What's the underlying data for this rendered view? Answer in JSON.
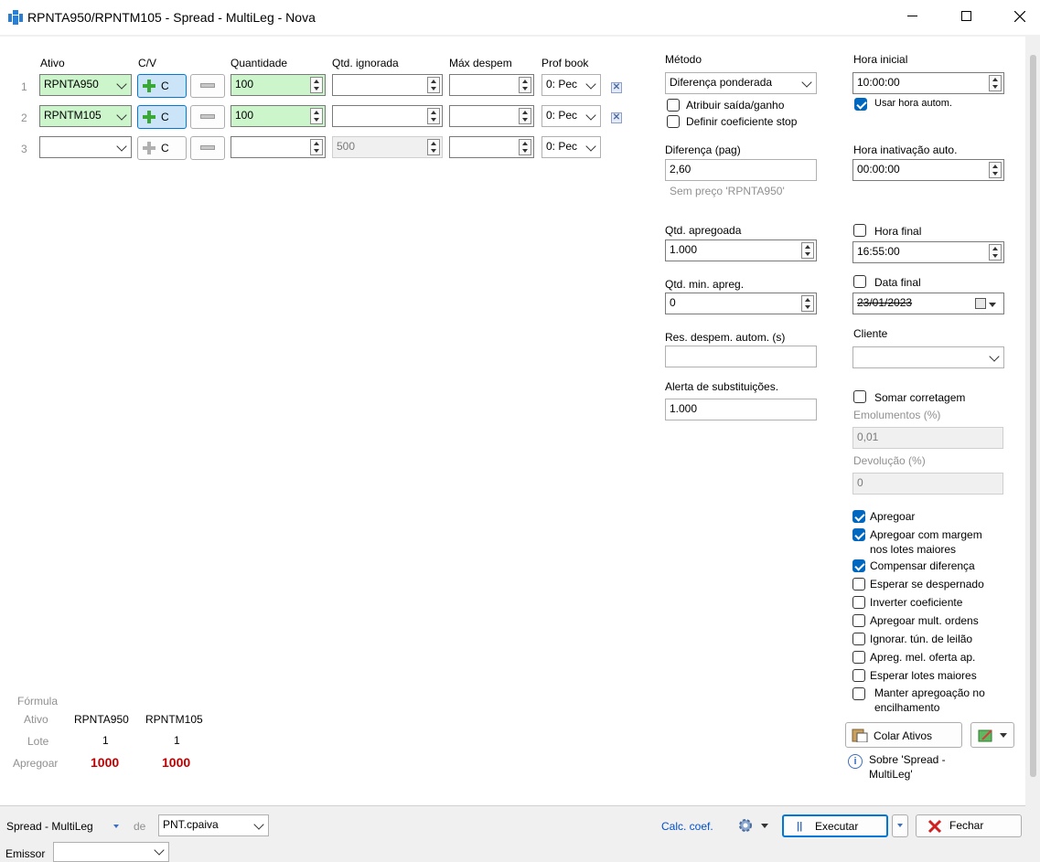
{
  "window": {
    "title": "RPNTA950/RPNTM105 - Spread - MultiLeg - Nova"
  },
  "grid": {
    "headers": {
      "ativo": "Ativo",
      "cv": "C/V",
      "quantidade": "Quantidade",
      "qtd_ignorada": "Qtd. ignorada",
      "max_despem": "Máx despem",
      "prof_book": "Prof book"
    },
    "rows": [
      {
        "num": "1",
        "ativo": "RPNTA950",
        "cv": "C",
        "quantidade": "100",
        "qtd_ignorada": "",
        "max_despem": "",
        "prof_book": "0: Pec"
      },
      {
        "num": "2",
        "ativo": "RPNTM105",
        "cv": "C",
        "quantidade": "100",
        "qtd_ignorada": "",
        "max_despem": "",
        "prof_book": "0: Pec"
      },
      {
        "num": "3",
        "ativo": "",
        "cv": "C",
        "quantidade": "",
        "qtd_ignorada": "500",
        "max_despem": "",
        "prof_book": "0: Pec"
      }
    ]
  },
  "metodo": {
    "label": "Método",
    "value": "Diferença ponderada",
    "atribuir": "Atribuir saída/ganho",
    "definir": "Definir coeficiente stop"
  },
  "diferenca": {
    "label": "Diferença (pag)",
    "value": "2,60",
    "hint": "Sem preço 'RPNTA950'"
  },
  "qtd_apregoada": {
    "label": "Qtd. apregoada",
    "value": "1.000"
  },
  "qtd_min": {
    "label": "Qtd. min. apreg.",
    "value": "0"
  },
  "res_despem": {
    "label": "Res. despem. autom. (s)",
    "value": ""
  },
  "alerta": {
    "label": "Alerta de substituições.",
    "value": "1.000"
  },
  "hora_inicial": {
    "label": "Hora inicial",
    "value": "10:00:00",
    "usar": "Usar hora autom."
  },
  "hora_inativ": {
    "label": "Hora inativação auto.",
    "value": "00:00:00"
  },
  "hora_final": {
    "label": "Hora final",
    "value": "16:55:00"
  },
  "data_final": {
    "label": "Data final",
    "value": "23/01/2023"
  },
  "cliente": {
    "label": "Cliente",
    "value": ""
  },
  "corretagem": {
    "label": "Somar corretagem"
  },
  "emolumentos": {
    "label": "Emolumentos (%)",
    "value": "0,01"
  },
  "devolucao": {
    "label": "Devolução (%)",
    "value": "0"
  },
  "options": [
    {
      "label": "Apregoar",
      "on": true
    },
    {
      "label": "Apregoar com margem",
      "label2": "nos lotes maiores",
      "on": true
    },
    {
      "label": "Compensar diferença",
      "on": true
    },
    {
      "label": "Esperar se despernado",
      "on": false
    },
    {
      "label": "Inverter coeficiente",
      "on": false
    },
    {
      "label": "Apregoar mult. ordens",
      "on": false
    },
    {
      "label": "Ignorar. tún. de leilão",
      "on": false
    },
    {
      "label": "Apreg. mel. oferta ap.",
      "on": false
    },
    {
      "label": "Esperar lotes maiores",
      "on": false
    },
    {
      "label": "Manter apregoação no",
      "label2": "encilhamento",
      "on": false
    }
  ],
  "colar": {
    "label": "Colar Ativos"
  },
  "sobre": {
    "line1": "Sobre 'Spread -",
    "line2": "MultiLeg'"
  },
  "formula": {
    "title": "Fórmula",
    "row_ativo": "Ativo",
    "row_lote": "Lote",
    "row_apregoar": "Apregoar",
    "cols": [
      {
        "ativo": "RPNTA950",
        "lote": "1",
        "apregoar": "1000"
      },
      {
        "ativo": "RPNTM105",
        "lote": "1",
        "apregoar": "1000"
      }
    ]
  },
  "footer": {
    "strategy": "Spread - MultiLeg",
    "de": "de",
    "account": "PNT.cpaiva",
    "calc": "Calc. coef.",
    "executar": "Executar",
    "fechar": "Fechar",
    "emissor": "Emissor",
    "emissor_value": ""
  }
}
